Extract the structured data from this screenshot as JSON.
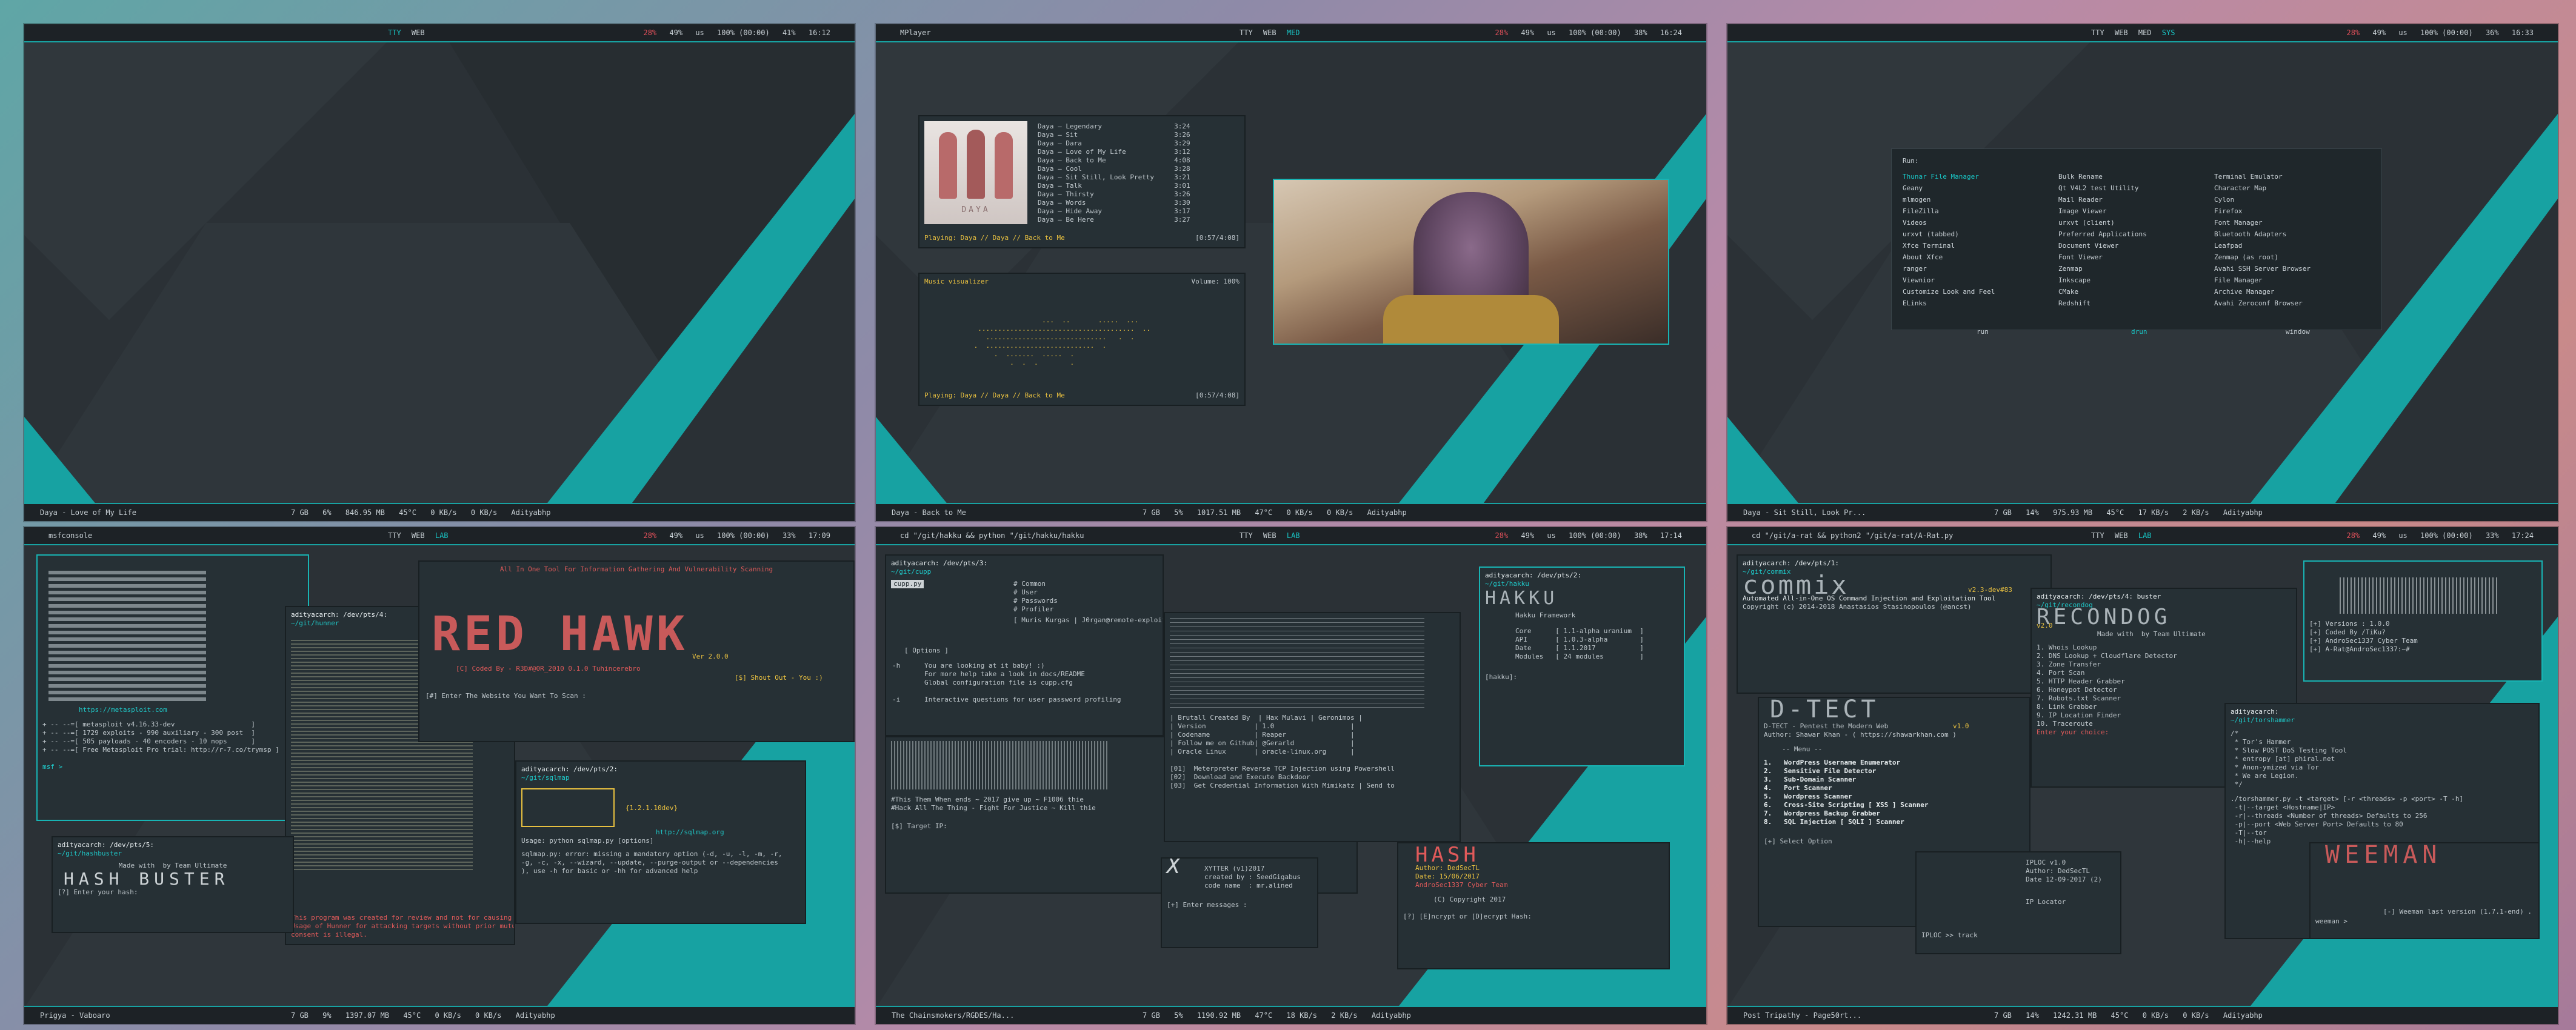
{
  "colors": {
    "accent": "#17a2a2",
    "bar": "#1d2226",
    "terminal": "#263035",
    "alert": "#e0505a",
    "text": "#c9d1d6"
  },
  "screens": [
    {
      "title": "Daya - Love of My Life",
      "bottom_title": "Daya - Love of My Life",
      "workspaces": [
        "TTY",
        "WEB"
      ],
      "stats": {
        "cpu": "28%",
        "mem": "49%",
        "kb": "us",
        "vol": "100% (00:00)",
        "bat": "41%",
        "time": "16:12"
      },
      "bottom": {
        "load": "7 GB",
        "proc": "6%",
        "mem": "846.95 MB",
        "temp": "45°C",
        "down": "0 KB/s",
        "up": "0 KB/s",
        "user": "Adityabhp"
      }
    },
    {
      "title": "MPlayer",
      "bottom_title": "Daya - Back to Me",
      "workspaces": [
        "TTY",
        "WEB",
        "MED"
      ],
      "stats": {
        "cpu": "28%",
        "mem": "49%",
        "kb": "us",
        "vol": "100% (00:00)",
        "bat": "38%",
        "time": "16:24"
      },
      "bottom": {
        "load": "7 GB",
        "proc": "5%",
        "mem": "1017.51 MB",
        "temp": "47°C",
        "down": "0 KB/s",
        "up": "0 KB/s",
        "user": "Adityabhp"
      },
      "tracks": [
        "Daya – Legendary",
        "Daya – Sit",
        "Daya – Dara",
        "Daya – Love of My Life",
        "Daya – Back to Me",
        "Daya – Cool",
        "Daya – Sit Still, Look Pretty",
        "Daya – Talk",
        "Daya – Thirsty",
        "Daya – Words",
        "Daya – Hide Away",
        "Daya – Be Here"
      ],
      "durations": [
        "3:24",
        "3:26",
        "3:29",
        "3:12",
        "4:08",
        "3:28",
        "3:21",
        "3:01",
        "3:26",
        "3:30",
        "3:17",
        "3:27"
      ],
      "playing": "Playing: Daya // Daya // Back to Me",
      "progress": "[0:57/4:08]",
      "album_label": "DAYA",
      "visualizer_title": "Music visualizer",
      "volume": "Volume: 100%",
      "viz_art": "                          ...  ..       .....  ...\n          .......................................  ..\n            ..............................   .  .\n         .  ...........................  .\n              .  .......  .....  .\n                  .  .  .        ."
    },
    {
      "title": "",
      "bottom_title": "Daya - Sit Still, Look Pr...",
      "workspaces": [
        "TTY",
        "WEB",
        "MED",
        "SYS"
      ],
      "stats": {
        "cpu": "28%",
        "mem": "49%",
        "kb": "us",
        "vol": "100% (00:00)",
        "bat": "36%",
        "time": "16:33"
      },
      "bottom": {
        "load": "7 GB",
        "proc": "14%",
        "mem": "975.93 MB",
        "temp": "45°C",
        "down": "17 KB/s",
        "up": "2 KB/s",
        "user": "Adityabhp"
      },
      "launcher_label": "Run:",
      "launcher_col1": [
        "Thunar File Manager",
        "Geany",
        "mlmogen",
        "FileZilla",
        "Videos",
        "urxvt (tabbed)",
        "Xfce Terminal",
        "About Xfce",
        "ranger",
        "Viewnior",
        "Customize Look and Feel",
        "ELinks"
      ],
      "launcher_col2": [
        "Bulk Rename",
        "Qt V4L2 test Utility",
        "Mail Reader",
        "Image Viewer",
        "urxvt (client)",
        "Preferred Applications",
        "Document Viewer",
        "Font Viewer",
        "Zenmap",
        "Inkscape",
        "CMake",
        "Redshift"
      ],
      "launcher_col3": [
        "Terminal Emulator",
        "Character Map",
        "Cylon",
        "Firefox",
        "Font Manager",
        "Bluetooth Adapters",
        "Leafpad",
        "Zenmap (as root)",
        "Avahi SSH Server Browser",
        "File Manager",
        "Archive Manager",
        "Avahi Zeroconf Browser"
      ],
      "launcher_tabs": [
        "run",
        "drun",
        "window"
      ]
    },
    {
      "title": "msfconsole",
      "bottom_title": "Prigya - Vaboaro",
      "workspaces": [
        "TTY",
        "WEB",
        "LAB"
      ],
      "stats": {
        "cpu": "28%",
        "mem": "49%",
        "kb": "us",
        "vol": "100% (00:00)",
        "bat": "33%",
        "time": "17:09"
      },
      "bottom": {
        "load": "7 GB",
        "proc": "9%",
        "mem": "1397.07 MB",
        "temp": "45°C",
        "down": "0 KB/s",
        "up": "0 KB/s",
        "user": "Adityabhp"
      },
      "msf_url": "https://metasploit.com",
      "msf_info": "+ -- --=[ metasploit v4.16.33-dev                   ]\n+ -- --=[ 1729 exploits - 990 auxiliary - 300 post  ]\n+ -- --=[ 505 payloads - 40 encoders - 10 nops      ]\n+ -- --=[ Free Metasploit Pro trial: http://r-7.co/trymsp ]",
      "msf_prompt": "msf >",
      "redhawk_title": "All In One Tool For Information Gathering And Vulnerability Scanning",
      "redhawk_coded": "[C] Coded By - R3D#@0R_2010 0.1.0 Tuhincerebro",
      "redhawk_version": "Ver 2.0.0",
      "redhawk_shout": "[$] Shout Out - You :)",
      "redhawk_enter": "[#] Enter The Website You Want To Scan :",
      "sqlmap_prompt": "adityacarch: /dev/pts/2:",
      "sqlmap_dir": "~/git/sqlmap",
      "sqlmap_ver": "{1.2.1.10dev}",
      "sqlmap_url": "http://sqlmap.org",
      "sqlmap_usage": "Usage: python sqlmap.py [options]",
      "sqlmap_error": "sqlmap.py: error: missing a mandatory option (-d, -u, -l, -m, -r,\n-g, -c, -x, --wizard, --update, --purge-output or --dependencies\n), use -h for basic or -hh for advanced help",
      "hunner_prompt": "adityacarch: /dev/pts/4:",
      "hunner_dir": "~/git/hunner",
      "hunner_note": "This program was created for review and not for causing harm.\nUsage of Hunner for attacking targets without prior mutual\nconsent is illegal.",
      "hashbuster_prompt": "adityacarch: /dev/pts/5:",
      "hashbuster_dir": "~/git/hashbuster",
      "hashbuster_made": "Made with  by Team Ultimate",
      "hashbuster_enter": "[?] Enter your hash:"
    },
    {
      "title": "cd \"/git/hakku && python \"/git/hakku/hakku",
      "bottom_title": "The Chainsmokers/RGDES/Ha...",
      "workspaces": [
        "TTY",
        "WEB",
        "LAB"
      ],
      "stats": {
        "cpu": "28%",
        "mem": "49%",
        "kb": "us",
        "vol": "100% (00:00)",
        "bat": "38%",
        "time": "17:14"
      },
      "bottom": {
        "load": "7 GB",
        "proc": "5%",
        "mem": "1190.92 MB",
        "temp": "47°C",
        "down": "18 KB/s",
        "up": "2 KB/s",
        "user": "Adityabhp"
      },
      "cupp_prompt": "adityacarch: /dev/pts/3:",
      "cupp_dir": "~/git/cupp",
      "cupp_cmd": "cupp.py",
      "cupp_menu": "# Common\n# User\n# Passwords\n# Profiler",
      "cupp_author": "[ Muris Kurgas | J0rgan@remote-exploit.org ]",
      "cupp_options": "[ Options ]",
      "cupp_text": "-h      You are looking at it baby! :)\n        For more help take a look in docs/README\n        Global configuration file is cupp.cfg\n\n-i      Interactive questions for user password profiling",
      "cupp_target": "[$] Target IP:",
      "hakku_prompt": "adityacarch: /dev/pts/2:",
      "hakku_dir": "~/git/hakku",
      "hakku_name": "Hakku Framework",
      "hakku_info": "Core      [ 1.1-alpha uranium  ]\nAPI       [ 1.0.3-alpha        ]\nDate      [ 1.1.2017           ]\nModules   [ 24 modules         ]",
      "hakku_cli": "[hakku]:",
      "chaos_info": "| Brutall Created By  | Hax Mulavi | Geronimos |\n| Version            | 1.0                   |\n| Codename           | Reaper                |\n| Follow me on Github| @Gerarld              |\n| Oracle Linux       | oracle-linux.org      |",
      "chaos_opts": "[01]  Meterpreter Reverse TCP Injection using Powershell\n[02]  Download and Execute Backdoor\n[03]  Get Credential Information With Mimikatz | Send to",
      "chaos_target": "[$] Target IP:",
      "chaos_footer": "#This Them When ends ~ 2017 give up ~ F1006 thie\n#Hack All The Thing - Fight For Justice ~ Kill thie",
      "hashbuster_author": "Author: DedSecTL",
      "hashbuster_date": "Date: 15/06/2017",
      "hashbuster_team": "AndroSec1337 Cyber Team",
      "hashbuster_copy": "(C) Copyright 2017",
      "hashbuster_input": "[?] [E]ncrypt or [D]ecrypt Hash:",
      "xpytool": "XYTTER (v1)2017\ncreated by : SeedGigabus\ncode name  : mr.alined",
      "enter_msg": "[+] Enter messages :"
    },
    {
      "title": "cd \"/git/a-rat && python2 \"/git/a-rat/A-Rat.py",
      "bottom_title": "Post Tripathy - Page50rt...",
      "workspaces": [
        "TTY",
        "WEB",
        "LAB"
      ],
      "stats": {
        "cpu": "28%",
        "mem": "49%",
        "kb": "us",
        "vol": "100% (00:00)",
        "bat": "33%",
        "time": "17:24"
      },
      "bottom": {
        "load": "7 GB",
        "proc": "14%",
        "mem": "1242.31 MB",
        "temp": "45°C",
        "down": "0 KB/s",
        "up": "0 KB/s",
        "user": "Adityabhp"
      },
      "commix_prompt": "adityacarch: /dev/pts/1:",
      "commix_dir": "~/git/commix",
      "commix_ver": "v2.3-dev#83",
      "commix_tag": "Automated All-in-One OS Command Injection and Exploitation Tool",
      "commix_copy": "Copyright (c) 2014-2018 Anastasios Stasinopoulos (@ancst)",
      "recon_prompt": "adityacarch: /dev/pts/4: buster",
      "recon_dir": "~/git/recondog",
      "recon_ver": "v2.0",
      "recon_made": "Made with  by Team Ultimate",
      "recon_list": "1. Whois Lookup\n2. DNS Lookup + Cloudflare Detector\n3. Zone Transfer\n4. Port Scan\n5. HTTP Header Grabber\n6. Honeypot Detector\n7. Robots.txt Scanner\n8. Link Grabber\n9. IP Location Finder\n10. Traceroute",
      "recon_enter": "Enter your choice:",
      "dtect_ver": "v1.0",
      "dtect_line1": "D-TECT - Pentest the Modern Web",
      "dtect_line2": "Author: Shawar Khan - ( https://shawarkhan.com )",
      "dtect_menu_title": "-- Menu --",
      "dtect_menu": "1.   WordPress Username Enumerator\n2.   Sensitive File Detector\n3.   Sub-Domain Scanner\n4.   Port Scanner\n5.   Wordpress Scanner\n6.   Cross-Site Scripting [ XSS ] Scanner\n7.   Wordpress Backup Grabber\n8.   SQL Injection [ SQLI ] Scanner",
      "dtect_select": "[+] Select Option",
      "iploc_title": "IPLOC v1.0",
      "iploc_author": "Author: DedSecTL",
      "iploc_date": "Date 12-09-2017 (2)",
      "iploc_name": "IP Locator",
      "iploc_input": "IPLOC >> track",
      "arat_info": "[+] Versions : 1.0.0\n[+] Coded By /TiKu?\n[+] AndroSec1337 Cyber Team",
      "arat_prompt": "[+] A-Rat@AndroSec1337:~#",
      "tor_prompt": "adityacarch:",
      "tor_dir": "~/git/torshammer",
      "tor_info": "/*\n * Tor's Hammer\n * Slow POST DoS Testing Tool\n * entropy [at] phiral.net\n * Anon-ymized via Tor\n * We are Legion.\n */",
      "tor_usage": "./torshammer.py -t <target> [-r <threads> -p <port> -T -h]\n -t|--target <Hostname|IP>\n -r|--threads <Number of threads> Defaults to 256\n -p|--port <Web Server Port> Defaults to 80\n -T|--tor\n -h|--help",
      "weeman_prompt": "weeman >",
      "weeman_ver": "[-] Weeman last version (1.7.1-end) ."
    }
  ]
}
